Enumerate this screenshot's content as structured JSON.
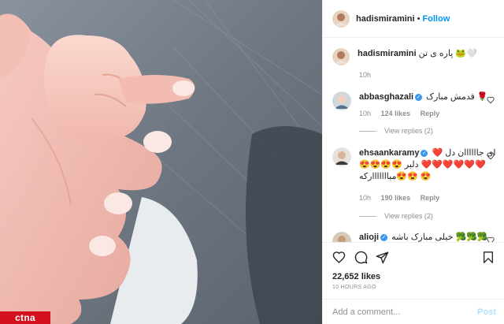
{
  "header": {
    "username": "hadismiramini",
    "dot": "•",
    "follow_label": "Follow"
  },
  "caption": {
    "username": "hadismiramini",
    "text": "پاره ی تن 🐸🤍",
    "time": "10h"
  },
  "comments": [
    {
      "username": "abbasghazali",
      "text": "قدمش مبارک 🌹",
      "time": "10h",
      "likes": "124 likes",
      "reply": "Reply",
      "view_replies": "View replies (2)"
    },
    {
      "username": "ehsaankaramy",
      "text": "ای جاااااان دل ❤️❤️❤️❤️❤️❤️❤️ دلبر 😍😍😍😍😍😍مبااااااارکه 😍",
      "time": "10h",
      "likes": "190 likes",
      "reply": "Reply",
      "view_replies": "View replies (2)"
    },
    {
      "username": "alioji",
      "text": "خیلی مبارک باشه 🥦🥦🥦",
      "time": "",
      "likes": "",
      "reply": "",
      "view_replies": ""
    }
  ],
  "likes_count": "22,652 likes",
  "posted_ago": "10 HOURS AGO",
  "add_comment": {
    "placeholder": "Add a comment...",
    "post_label": "Post"
  },
  "watermark": "ctna",
  "colors": {
    "link_blue": "#0095f6",
    "verified": "#3897f0",
    "text": "#262626",
    "muted": "#8e8e8e",
    "watermark_red": "#d4121e"
  },
  "icons": [
    "heart-icon",
    "comment-icon",
    "share-icon",
    "bookmark-icon",
    "verified-icon"
  ]
}
